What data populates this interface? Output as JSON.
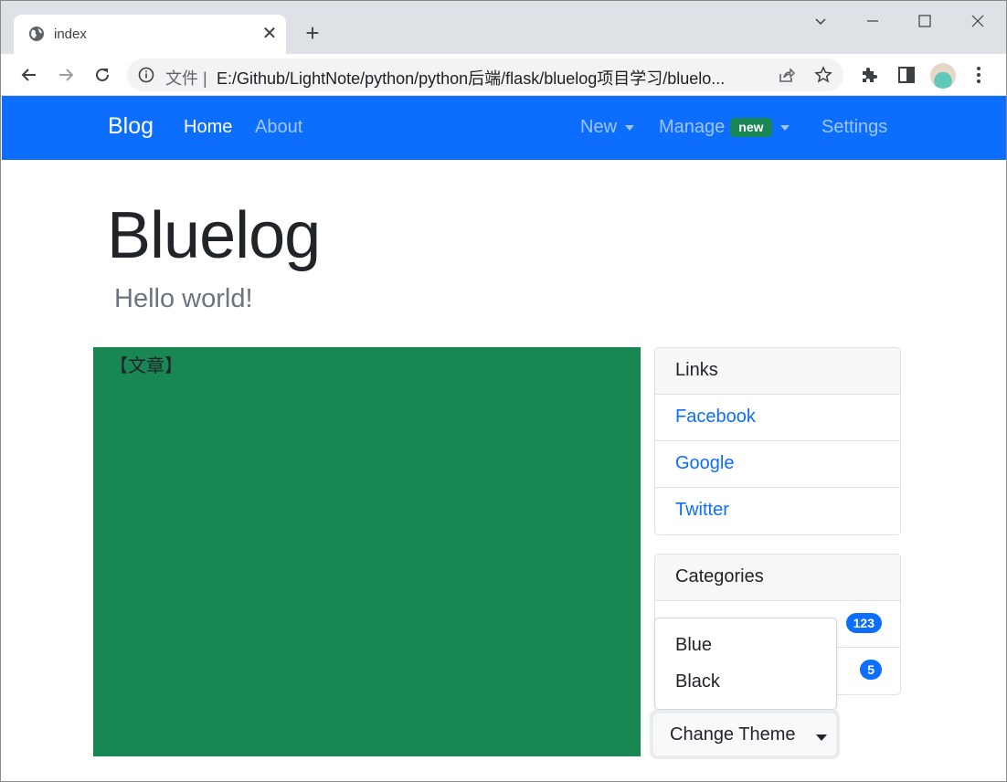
{
  "browser": {
    "tab_title": "index",
    "tab_close": "✕",
    "new_tab": "+",
    "url_label": "文件 |",
    "url": "E:/Github/LightNote/python/python后端/flask/bluelog项目学习/bluelo..."
  },
  "navbar": {
    "brand": "Blog",
    "left_links": [
      "Home",
      "About"
    ],
    "new_label": "New",
    "manage_label": "Manage",
    "manage_badge": "new",
    "settings_label": "Settings"
  },
  "header": {
    "title": "Bluelog",
    "subtitle": "Hello world!"
  },
  "article": {
    "placeholder": "【文章】"
  },
  "links_card": {
    "header": "Links",
    "items": [
      "Facebook",
      "Google",
      "Twitter"
    ]
  },
  "categories_card": {
    "header": "Categories",
    "items": [
      {
        "label": "",
        "count": "123"
      },
      {
        "label": "",
        "count": "5"
      }
    ]
  },
  "theme_dropdown": {
    "options": [
      "Blue",
      "Black"
    ],
    "button_label": "Change Theme"
  },
  "colors": {
    "navbar": "#0d6efd",
    "article_bg": "#198754",
    "badge_new": "#198754",
    "pill": "#0d6efd"
  }
}
